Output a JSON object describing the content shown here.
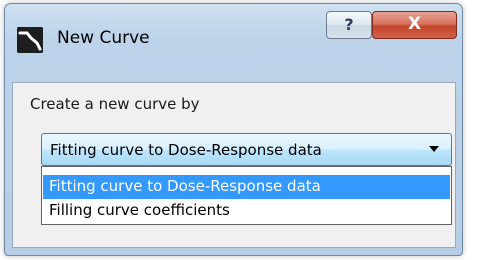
{
  "window": {
    "title": "New Curve"
  },
  "titlebar": {
    "help_label": "?",
    "close_label": "X"
  },
  "form": {
    "prompt": "Create a new curve by",
    "combo_value": "Fitting curve to Dose-Response data",
    "options": [
      "Fitting curve to Dose-Response data",
      "Filling curve coefficients"
    ],
    "selected_option": "Fitting curve to Dose-Response data"
  },
  "icons": {
    "app": "curve-app-icon",
    "dropdown": "chevron-down-icon"
  },
  "colors": {
    "selection": "#3399ff",
    "close_button": "#c4452b",
    "window_frame": "#b6cde5"
  }
}
